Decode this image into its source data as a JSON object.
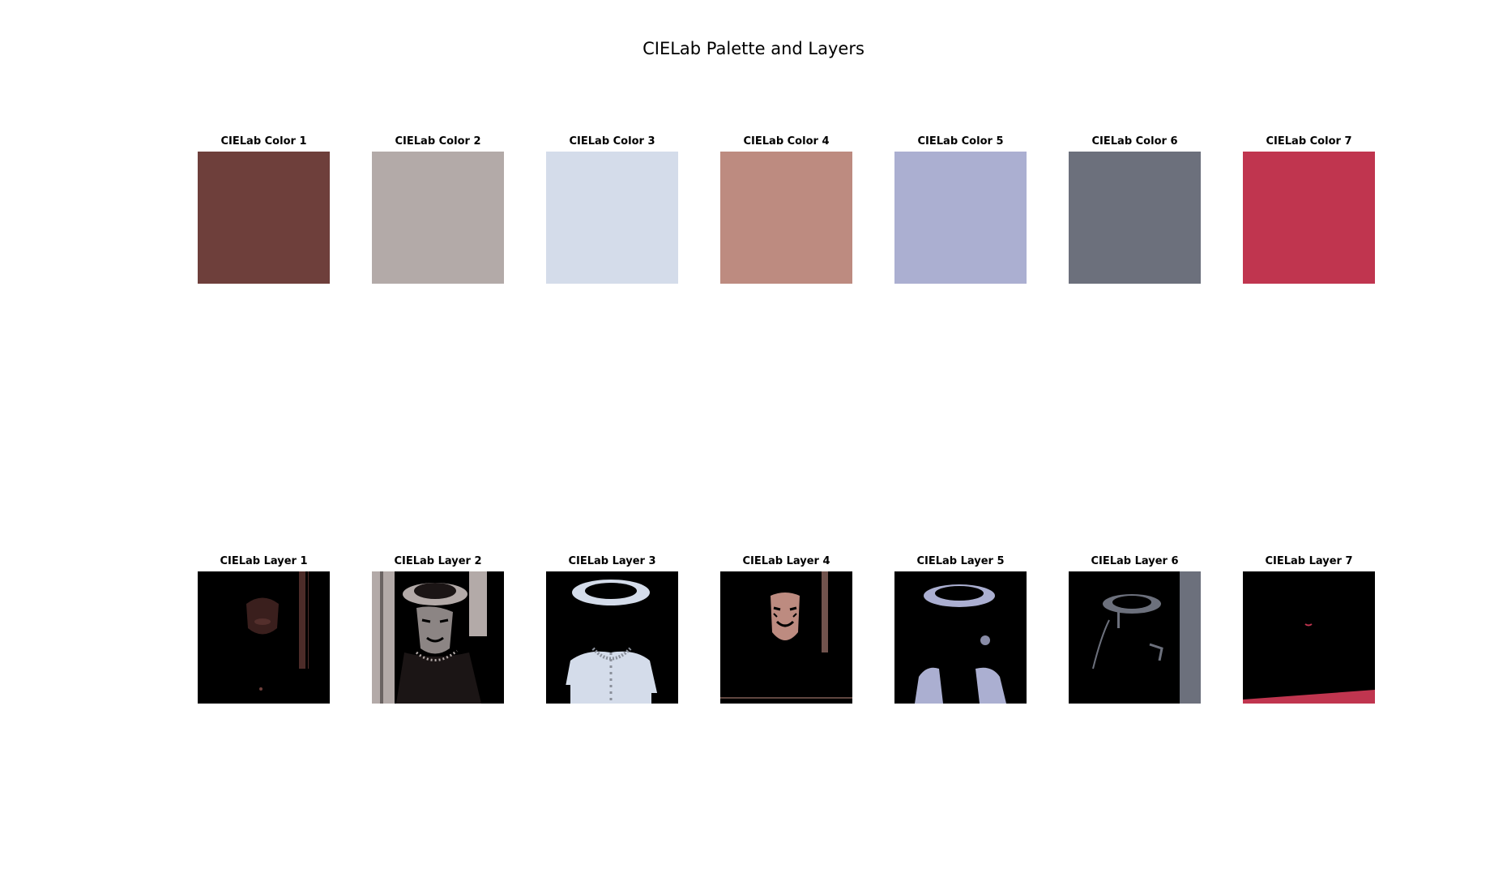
{
  "title": "CIELab Palette and Layers",
  "palette": [
    {
      "label": "CIELab Color 1",
      "color": "#6e3f3b"
    },
    {
      "label": "CIELab Color 2",
      "color": "#b3aaa8"
    },
    {
      "label": "CIELab Color 3",
      "color": "#d4dcea"
    },
    {
      "label": "CIELab Color 4",
      "color": "#bd8b80"
    },
    {
      "label": "CIELab Color 5",
      "color": "#abafd1"
    },
    {
      "label": "CIELab Color 6",
      "color": "#6c707c"
    },
    {
      "label": "CIELab Color 7",
      "color": "#c0354f"
    }
  ],
  "layers": [
    {
      "label": "CIELab Layer 1"
    },
    {
      "label": "CIELab Layer 2"
    },
    {
      "label": "CIELab Layer 3"
    },
    {
      "label": "CIELab Layer 4"
    },
    {
      "label": "CIELab Layer 5"
    },
    {
      "label": "CIELab Layer 6"
    },
    {
      "label": "CIELab Layer 7"
    }
  ]
}
